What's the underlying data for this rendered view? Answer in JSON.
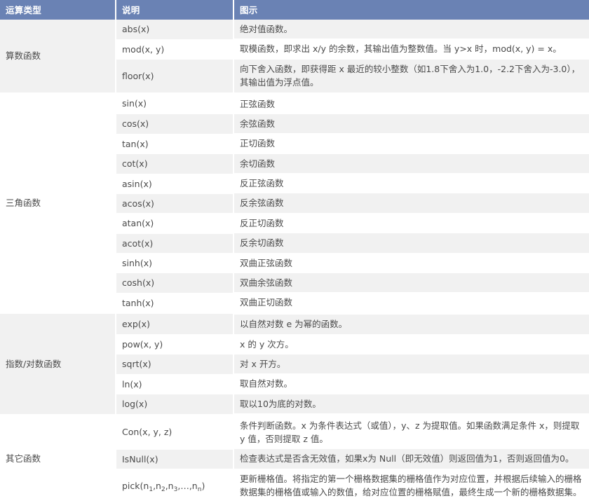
{
  "table": {
    "headers": [
      "运算类型",
      "说明",
      "图示"
    ],
    "groups": [
      {
        "category": "算数函数",
        "rows": [
          {
            "name": "abs(x)",
            "desc": "绝对值函数。"
          },
          {
            "name": "mod(x, y)",
            "desc": "取模函数，即求出 x/y 的余数，其输出值为整数值。当 y>x 时，mod(x, y) = x。"
          },
          {
            "name": "floor(x)",
            "desc": "向下舍入函数，即获得距 x 最近的较小整数（如1.8下舍入为1.0，-2.2下舍入为-3.0），其输出值为浮点值。"
          }
        ]
      },
      {
        "category": "三角函数",
        "rows": [
          {
            "name": "sin(x)",
            "desc": "正弦函数"
          },
          {
            "name": "cos(x)",
            "desc": "余弦函数"
          },
          {
            "name": "tan(x)",
            "desc": "正切函数"
          },
          {
            "name": "cot(x)",
            "desc": "余切函数"
          },
          {
            "name": "asin(x)",
            "desc": "反正弦函数"
          },
          {
            "name": "acos(x)",
            "desc": "反余弦函数"
          },
          {
            "name": "atan(x)",
            "desc": "反正切函数"
          },
          {
            "name": "acot(x)",
            "desc": "反余切函数"
          },
          {
            "name": "sinh(x)",
            "desc": "双曲正弦函数"
          },
          {
            "name": "cosh(x)",
            "desc": "双曲余弦函数"
          },
          {
            "name": "tanh(x)",
            "desc": "双曲正切函数"
          }
        ]
      },
      {
        "category": "指数/对数函数",
        "rows": [
          {
            "name": "exp(x)",
            "desc": "以自然对数 e 为幂的函数。"
          },
          {
            "name": "pow(x, y)",
            "desc": "x 的 y 次方。"
          },
          {
            "name": "sqrt(x)",
            "desc": "对 x 开方。"
          },
          {
            "name": "ln(x)",
            "desc": "取自然对数。"
          },
          {
            "name": "log(x)",
            "desc": "取以10为底的对数。"
          }
        ]
      },
      {
        "category": "其它函数",
        "rows": [
          {
            "name": "Con(x, y, z)",
            "desc": "条件判断函数。x 为条件表达式（或值），y、z 为提取值。如果函数满足条件 x，则提取 y 值，否则提取 z 值。"
          },
          {
            "name": "IsNull(x)",
            "desc": "检查表达式是否含无效值，如果x为 Null（即无效值）则返回值为1，否则返回值为0。"
          },
          {
            "name": "pick(n1,n2,n3,...,nn)",
            "name_html": "pick(n<sub>1</sub>,n<sub>2</sub>,n<sub>3</sub>,…,n<sub>n</sub>)",
            "desc": "更新栅格值。将指定的第一个栅格数据集的栅格值作为对应位置，并根据后续输入的栅格数据集的栅格值或输入的数值，给对应位置的栅格赋值，最终生成一个新的栅格数据集。"
          }
        ]
      }
    ]
  },
  "colors": {
    "header_bg": "#6a82b4",
    "header_text": "#ffffff",
    "stripe_bg": "#f1f1f1",
    "row_bg": "#ffffff",
    "text": "#4a4a4a"
  }
}
